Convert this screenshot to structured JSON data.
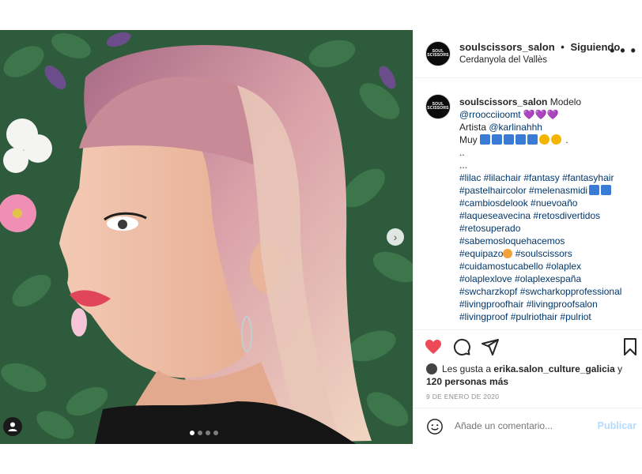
{
  "post": {
    "username": "soulscissors_salon",
    "separator": "•",
    "follow_status": "Siguiendo",
    "location": "Cerdanyola del Vallès",
    "more_icon": "more-icon",
    "avatar_text": "SOUL SCISSORS"
  },
  "caption": {
    "username": "soulscissors_salon",
    "line1_word": "Modelo",
    "model_handle": "@rroocciioomt",
    "hearts": "💜💜💜",
    "artist_label": "Artista",
    "artist_handle": "@karlinahhh",
    "muy": "Muy",
    "muy_end": " .",
    "dots1": "..",
    "dots2": "...",
    "hashtags": [
      "#lilac #lilachair #fantasy #fantasyhair",
      "#pastelhaircolor #melenasmidi",
      "#cambiosdelook #nuevoaño",
      "#laqueseavecina #retosdivertidos",
      "#retosuperado",
      "#sabemosloquehacemos",
      "#equipazo",
      "#cuidamostucabello #olaplex",
      "#olaplexlove #olaplexespaña",
      "#swcharzkopf #swcharkopprofessional",
      "#livingproofhair #livingproofsalon",
      "#livingproof #pulriothair #pulriot"
    ],
    "equipazo_tail": " #soulscissors"
  },
  "likes": {
    "prefix": "Les gusta a",
    "user": "erika.salon_culture_galicia",
    "connector": "y",
    "others": "120 personas más"
  },
  "date": "9 DE ENERO DE 2020",
  "comment": {
    "placeholder": "Añade un comentario...",
    "publish": "Publicar"
  },
  "carousel": {
    "count": 4,
    "active": 0
  },
  "colors": {
    "like_red": "#ed4956",
    "link_blue": "#00376b",
    "publish_blue": "#b3dbff"
  }
}
